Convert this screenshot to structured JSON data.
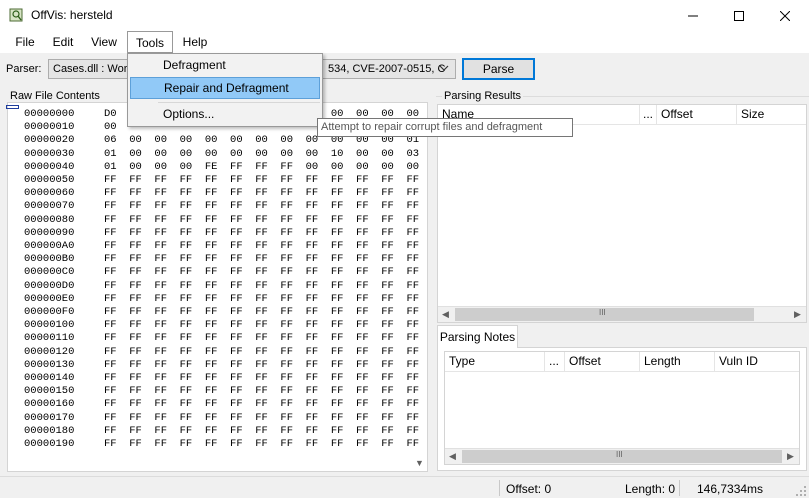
{
  "window": {
    "title": "OffVis: hersteld",
    "controls": [
      "minimize-icon",
      "maximize-icon",
      "close-icon"
    ]
  },
  "menubar": {
    "items": [
      "File",
      "Edit",
      "View",
      "Tools",
      "Help"
    ],
    "open_menu": "Tools"
  },
  "tools_menu": {
    "items": [
      "Defragment",
      "Repair and Defragment",
      "Options..."
    ],
    "highlighted": "Repair and Defragment",
    "tooltip": "Attempt to repair corrupt files and defragment"
  },
  "toolbar": {
    "parser_label": "Parser:",
    "parser_value_left": "Cases.dll : Wor",
    "parser_value_right": "534, CVE-2007-0515, C",
    "parse_button": "Parse"
  },
  "raw": {
    "label": "Raw File Contents",
    "rows": [
      {
        "addr": "00000000",
        "bytes": "D0                                  00  00  00  00"
      },
      {
        "addr": "00000010",
        "bytes": "00"
      },
      {
        "addr": "00000020",
        "bytes": "06  00  00  00  00  00  00  00  00  00  00  00  01"
      },
      {
        "addr": "00000030",
        "bytes": "01  00  00  00  00  00  00  00  00  10  00  00  03"
      },
      {
        "addr": "00000040",
        "bytes": "01  00  00  00  FE  FF  FF  FF  00  00  00  00  00"
      },
      {
        "addr": "00000050",
        "bytes": "FF  FF  FF  FF  FF  FF  FF  FF  FF  FF  FF  FF  FF"
      },
      {
        "addr": "00000060",
        "bytes": "FF  FF  FF  FF  FF  FF  FF  FF  FF  FF  FF  FF  FF"
      },
      {
        "addr": "00000070",
        "bytes": "FF  FF  FF  FF  FF  FF  FF  FF  FF  FF  FF  FF  FF"
      },
      {
        "addr": "00000080",
        "bytes": "FF  FF  FF  FF  FF  FF  FF  FF  FF  FF  FF  FF  FF"
      },
      {
        "addr": "00000090",
        "bytes": "FF  FF  FF  FF  FF  FF  FF  FF  FF  FF  FF  FF  FF"
      },
      {
        "addr": "000000A0",
        "bytes": "FF  FF  FF  FF  FF  FF  FF  FF  FF  FF  FF  FF  FF"
      },
      {
        "addr": "000000B0",
        "bytes": "FF  FF  FF  FF  FF  FF  FF  FF  FF  FF  FF  FF  FF"
      },
      {
        "addr": "000000C0",
        "bytes": "FF  FF  FF  FF  FF  FF  FF  FF  FF  FF  FF  FF  FF"
      },
      {
        "addr": "000000D0",
        "bytes": "FF  FF  FF  FF  FF  FF  FF  FF  FF  FF  FF  FF  FF"
      },
      {
        "addr": "000000E0",
        "bytes": "FF  FF  FF  FF  FF  FF  FF  FF  FF  FF  FF  FF  FF"
      },
      {
        "addr": "000000F0",
        "bytes": "FF  FF  FF  FF  FF  FF  FF  FF  FF  FF  FF  FF  FF"
      },
      {
        "addr": "00000100",
        "bytes": "FF  FF  FF  FF  FF  FF  FF  FF  FF  FF  FF  FF  FF"
      },
      {
        "addr": "00000110",
        "bytes": "FF  FF  FF  FF  FF  FF  FF  FF  FF  FF  FF  FF  FF"
      },
      {
        "addr": "00000120",
        "bytes": "FF  FF  FF  FF  FF  FF  FF  FF  FF  FF  FF  FF  FF"
      },
      {
        "addr": "00000130",
        "bytes": "FF  FF  FF  FF  FF  FF  FF  FF  FF  FF  FF  FF  FF"
      },
      {
        "addr": "00000140",
        "bytes": "FF  FF  FF  FF  FF  FF  FF  FF  FF  FF  FF  FF  FF"
      },
      {
        "addr": "00000150",
        "bytes": "FF  FF  FF  FF  FF  FF  FF  FF  FF  FF  FF  FF  FF"
      },
      {
        "addr": "00000160",
        "bytes": "FF  FF  FF  FF  FF  FF  FF  FF  FF  FF  FF  FF  FF"
      },
      {
        "addr": "00000170",
        "bytes": "FF  FF  FF  FF  FF  FF  FF  FF  FF  FF  FF  FF  FF"
      },
      {
        "addr": "00000180",
        "bytes": "FF  FF  FF  FF  FF  FF  FF  FF  FF  FF  FF  FF  FF"
      },
      {
        "addr": "00000190",
        "bytes": "FF  FF  FF  FF  FF  FF  FF  FF  FF  FF  FF  FF  FF"
      }
    ]
  },
  "results": {
    "label": "Parsing Results",
    "columns": [
      "Name",
      "...",
      "Offset",
      "Size"
    ],
    "hscroll_grip": "III"
  },
  "notes": {
    "tab_label": "Parsing Notes",
    "columns": [
      "Type",
      "...",
      "Offset",
      "Length",
      "Vuln ID"
    ],
    "hscroll_grip": "III"
  },
  "status": {
    "offset": "Offset: 0",
    "length": "Length: 0",
    "time": "146,7334ms"
  },
  "colors": {
    "menu_highlight": "#91c9f7",
    "parse_button_border": "#0078d7"
  }
}
